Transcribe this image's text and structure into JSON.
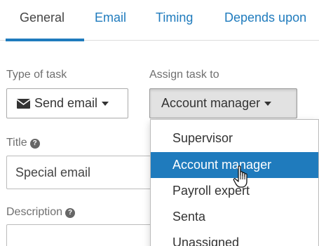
{
  "tabs": [
    "General",
    "Email",
    "Timing",
    "Depends upon"
  ],
  "type_of_task": {
    "label": "Type of task",
    "value": "Send email",
    "icon": "envelope-icon"
  },
  "assign_task": {
    "label": "Assign task to",
    "value": "Account manager",
    "options": [
      "Supervisor",
      "Account manager",
      "Payroll expert",
      "Senta",
      "Unassigned"
    ],
    "highlighted": "Account manager"
  },
  "title": {
    "label": "Title",
    "value": "Special email",
    "icon": "question-circle-icon"
  },
  "description": {
    "label": "Description",
    "icon": "question-circle-icon"
  },
  "colors": {
    "accent": "#1f7bbd",
    "pressed_button": "#e2e2e2",
    "text": "#444444"
  }
}
